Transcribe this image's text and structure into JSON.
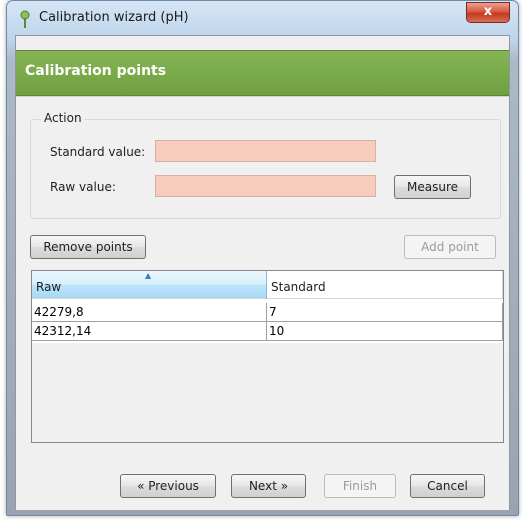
{
  "window": {
    "title": "Calibration wizard (pH)",
    "close_label": "x"
  },
  "header": {
    "title": "Calibration points"
  },
  "action": {
    "legend": "Action",
    "standard_label": "Standard value:",
    "standard_value": "",
    "raw_label": "Raw value:",
    "raw_value": "",
    "measure_label": "Measure"
  },
  "toolbar": {
    "remove_label": "Remove points",
    "add_label": "Add point"
  },
  "table": {
    "columns": [
      "Raw",
      "Standard"
    ],
    "sorted_column": "Raw",
    "rows": [
      [
        "42279,8",
        "7"
      ],
      [
        "42312,14",
        "10"
      ]
    ]
  },
  "footer": {
    "previous_label": "« Previous",
    "next_label": "Next »",
    "finish_label": "Finish",
    "cancel_label": "Cancel"
  },
  "colors": {
    "header_green": "#78a84a",
    "input_highlight": "#f6cdbd",
    "close_red": "#c8452b"
  }
}
